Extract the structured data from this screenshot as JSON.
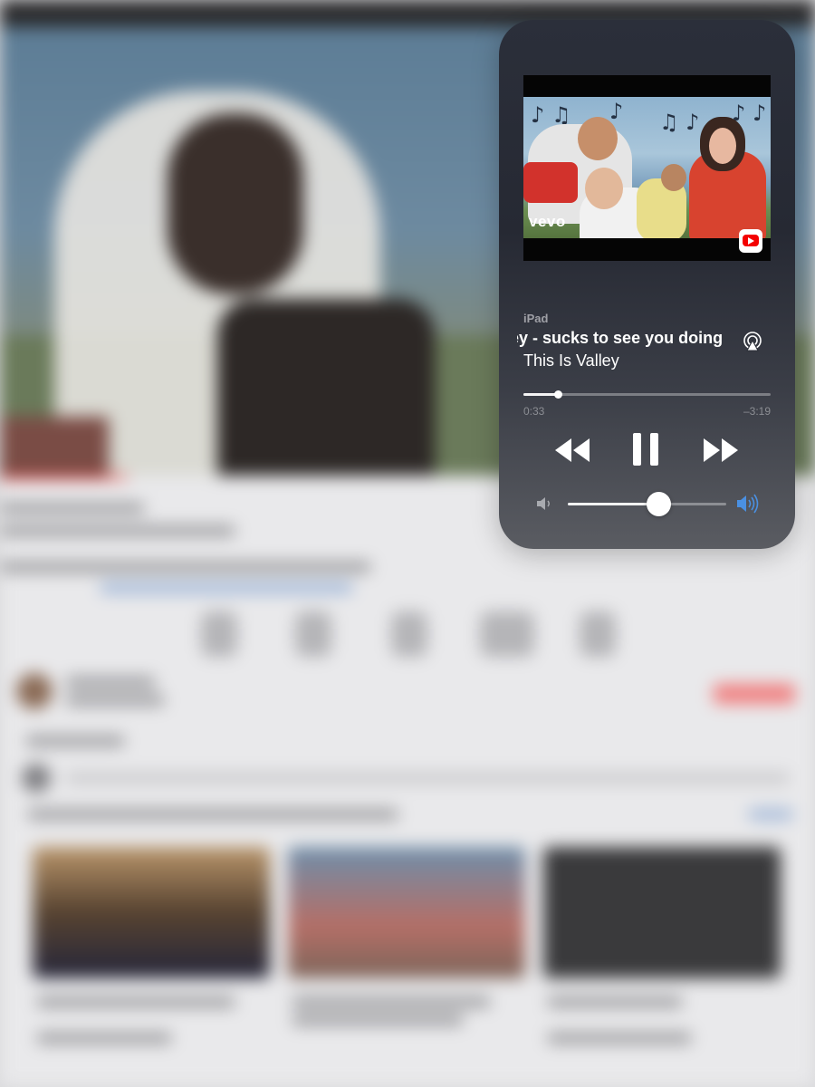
{
  "now_playing": {
    "device": "iPad",
    "track": "ey - sucks to see you doing",
    "artist": "This Is Valley",
    "video_overlay": "vevo",
    "elapsed": "0:33",
    "remaining": "–3:19",
    "progress_fraction": 0.14,
    "volume_fraction": 0.57,
    "controls": {
      "rewind_icon": "rewind-icon",
      "pause_icon": "pause-icon",
      "fast_forward_icon": "fast-forward-icon",
      "airplay_icon": "airplay-icon",
      "volume_low_icon": "volume-low-icon",
      "volume_high_icon": "volume-high-icon",
      "app_badge_icon": "youtube-icon"
    },
    "colors": {
      "accent_volume": "#4a90e2",
      "badge_red": "#f40000"
    }
  }
}
